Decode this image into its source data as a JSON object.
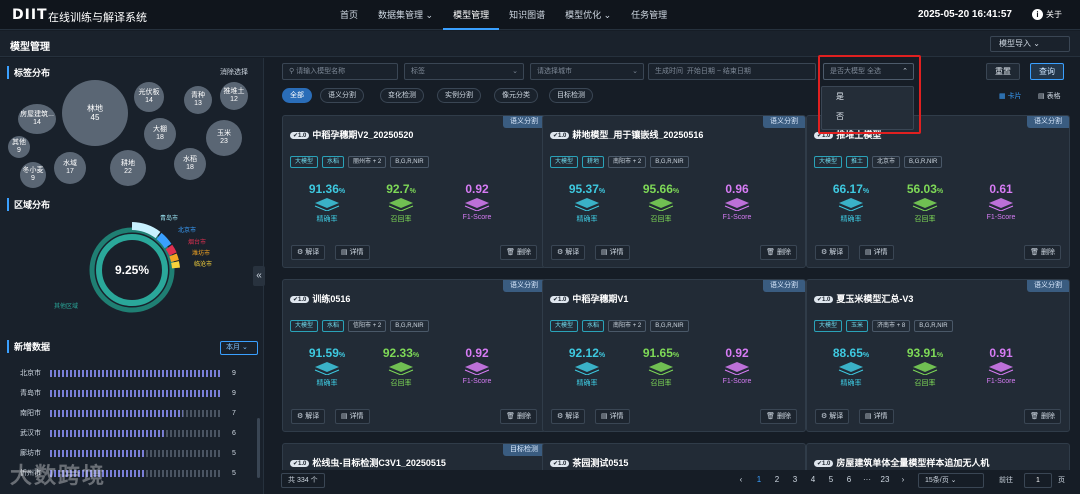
{
  "app": {
    "logo": "DIIT",
    "title": "在线训练与解译系统",
    "datetime": "2025-05-20 16:41:57",
    "about": "关于"
  },
  "nav": [
    {
      "label": "首页"
    },
    {
      "label": "数据集管理 ⌄"
    },
    {
      "label": "模型管理"
    },
    {
      "label": "知识图谱"
    },
    {
      "label": "模型优化 ⌄"
    },
    {
      "label": "任务管理"
    }
  ],
  "page": {
    "title": "模型管理",
    "import_label": "模型导入 ⌄"
  },
  "sidebar": {
    "tag_title": "标签分布",
    "clear": "消除选择",
    "bubbles": [
      {
        "label": "林地",
        "count": "45"
      },
      {
        "label": "光伏板",
        "count": "14"
      },
      {
        "label": "青种",
        "count": "13"
      },
      {
        "label": "推堆土",
        "count": "12"
      },
      {
        "label": "房屋建筑...",
        "count": "14"
      },
      {
        "label": "大棚",
        "count": "18"
      },
      {
        "label": "玉米",
        "count": "23"
      },
      {
        "label": "其他",
        "count": "9"
      },
      {
        "label": "水域",
        "count": "17"
      },
      {
        "label": "耕地",
        "count": "22"
      },
      {
        "label": "水稻",
        "count": "18"
      },
      {
        "label": "冬小麦",
        "count": "9"
      }
    ],
    "region_title": "区域分布",
    "region_center": "9.25%",
    "region_labels": [
      "青岛市",
      "北京市",
      "烟台市",
      "潍坊市",
      "临沧市",
      "其他区域"
    ],
    "new_title": "新增数据",
    "month": "本月 ⌄",
    "new_rows": [
      {
        "city": "北京市",
        "count": "9",
        "value": 9
      },
      {
        "city": "青岛市",
        "count": "9",
        "value": 9
      },
      {
        "city": "南阳市",
        "count": "7",
        "value": 7
      },
      {
        "city": "武汉市",
        "count": "6",
        "value": 6
      },
      {
        "city": "廊坊市",
        "count": "5",
        "value": 5
      },
      {
        "city": "忻州市",
        "count": "5",
        "value": 5
      }
    ]
  },
  "filters": {
    "name_placeholder": "请输入模型名称",
    "tag_placeholder": "标签",
    "city_placeholder": "请选择城市",
    "time_label": "生成时间",
    "start": "开始日期",
    "sep": "~",
    "end": "结束日期",
    "big_model": "是否大模型  全选",
    "reset": "重置",
    "query": "查询"
  },
  "chips": [
    "全部",
    "语义分割",
    "变化检测",
    "实例分割",
    "像元分类",
    "目标检测"
  ],
  "view": {
    "card": "卡片",
    "table": "表格"
  },
  "dropdown": {
    "options": [
      "是",
      "否"
    ]
  },
  "cards": [
    {
      "tag": "语义分割",
      "version": "1.0",
      "title": "中稻孕穗期V2_20250520",
      "labels": [
        "大模型",
        "水稻",
        "丽州市 + 2",
        "B,G,R,NIR"
      ],
      "m1": "91.36",
      "m2": "92.7",
      "m3": "0.92"
    },
    {
      "tag": "语义分割",
      "version": "1.0",
      "title": "耕地模型_用于镶嵌线_20250516",
      "labels": [
        "大模型",
        "耕地",
        "南阳市 + 2",
        "B,G,R,NIR"
      ],
      "m1": "95.37",
      "m2": "95.66",
      "m3": "0.96"
    },
    {
      "tag": "语义分割",
      "version": "1.0",
      "title": "推堆土模型",
      "labels": [
        "大模型",
        "推土",
        "北京市",
        "B,G,R,NIR"
      ],
      "m1": "66.17",
      "m2": "56.03",
      "m3": "0.61"
    },
    {
      "tag": "语义分割",
      "version": "1.0",
      "title": "训练0516",
      "labels": [
        "大模型",
        "水稻",
        "信阳市 + 2",
        "B,G,R,NIR"
      ],
      "m1": "91.59",
      "m2": "92.33",
      "m3": "0.92"
    },
    {
      "tag": "语义分割",
      "version": "1.0",
      "title": "中稻孕穗期V1",
      "labels": [
        "大模型",
        "水稻",
        "南阳市 + 2",
        "B,G,R,NIR"
      ],
      "m1": "92.12",
      "m2": "91.65",
      "m3": "0.92"
    },
    {
      "tag": "语义分割",
      "version": "1.0",
      "title": "夏玉米模型汇总-V3",
      "labels": [
        "大模型",
        "玉米",
        "济南市 + 8",
        "B,G,R,NIR"
      ],
      "m1": "88.65",
      "m2": "93.91",
      "m3": "0.91"
    },
    {
      "tag": "目标检测",
      "version": "1.0",
      "title": "松线虫-目标检测C3V1_20250515",
      "labels": [],
      "m1": "",
      "m2": "",
      "m3": ""
    },
    {
      "tag": "",
      "version": "1.0",
      "title": "茶园测试0515",
      "labels": [],
      "m1": "",
      "m2": "",
      "m3": ""
    },
    {
      "tag": "",
      "version": "1.0",
      "title": "房屋建筑单体全量模型样本追加无人机",
      "labels": [],
      "m1": "",
      "m2": "",
      "m3": ""
    }
  ],
  "metric_names": {
    "a": "精确率",
    "b": "召回率",
    "c": "F1-Score",
    "pct": "%"
  },
  "card_actions": {
    "interpret": "解译",
    "detail": "详情",
    "delete": "删除"
  },
  "pager": {
    "total": "共 334 个",
    "pages": [
      "‹",
      "1",
      "2",
      "3",
      "4",
      "5",
      "6",
      "···",
      "23",
      "›"
    ],
    "size": "15条/页 ⌄",
    "goto": "前往",
    "page": "1",
    "suffix": "页"
  },
  "watermark": "大数跨境",
  "colors": {
    "accent": "#3aa0ff",
    "precision": "#3ec9e0",
    "recall": "#7ed957",
    "f1": "#d77cf5"
  }
}
